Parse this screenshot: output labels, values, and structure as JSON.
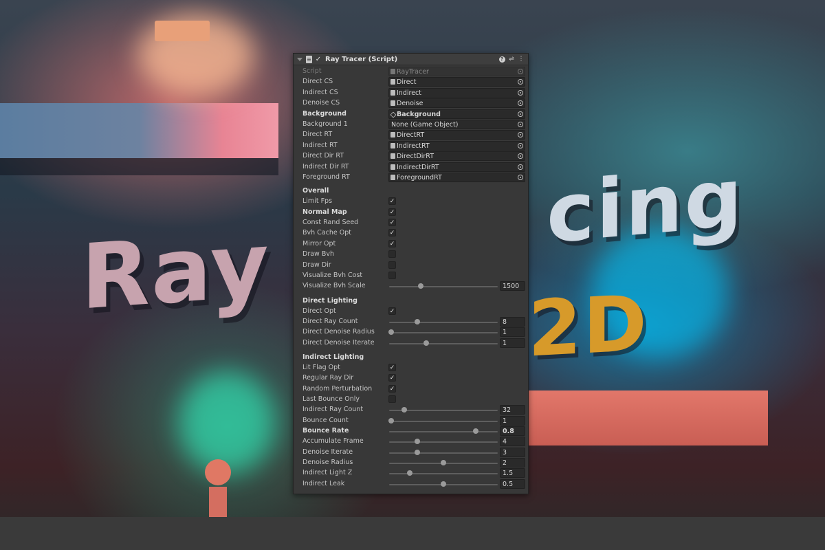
{
  "component": {
    "title": "Ray Tracer (Script)",
    "enabled": true,
    "icons": [
      "foldout-arrow-icon",
      "script-file-icon",
      "help-icon",
      "presets-icon",
      "kebab-menu-icon"
    ]
  },
  "object_fields": [
    {
      "label": "Script",
      "value": "RayTracer",
      "disabled": true,
      "kind": "script"
    },
    {
      "label": "Direct CS",
      "value": "Direct",
      "kind": "compute"
    },
    {
      "label": "Indirect CS",
      "value": "Indirect",
      "kind": "compute"
    },
    {
      "label": "Denoise CS",
      "value": "Denoise",
      "kind": "compute"
    },
    {
      "label": "Background",
      "value": "Background",
      "bold": true,
      "kind": "gameobject"
    },
    {
      "label": "Background 1",
      "value": "None (Game Object)",
      "kind": "none"
    },
    {
      "label": "Direct RT",
      "value": "DirectRT",
      "kind": "rendertexture"
    },
    {
      "label": "Indirect RT",
      "value": "IndirectRT",
      "kind": "rendertexture"
    },
    {
      "label": "Direct Dir RT",
      "value": "DirectDirRT",
      "kind": "rendertexture"
    },
    {
      "label": "Indirect Dir RT",
      "value": "IndirectDirRT",
      "kind": "rendertexture"
    },
    {
      "label": "Foreground RT",
      "value": "ForegroundRT",
      "kind": "rendertexture"
    }
  ],
  "sections": [
    {
      "title": "Overall",
      "fields": [
        {
          "label": "Limit Fps",
          "type": "toggle",
          "checked": true
        },
        {
          "label": "Normal Map",
          "type": "toggle",
          "checked": true,
          "bold": true
        },
        {
          "label": "Const Rand Seed",
          "type": "toggle",
          "checked": true
        },
        {
          "label": "Bvh Cache Opt",
          "type": "toggle",
          "checked": true
        },
        {
          "label": "Mirror Opt",
          "type": "toggle",
          "checked": true
        },
        {
          "label": "Draw Bvh",
          "type": "toggle",
          "checked": false
        },
        {
          "label": "Draw Dir",
          "type": "toggle",
          "checked": false
        },
        {
          "label": "Visualize Bvh Cost",
          "type": "toggle",
          "checked": false
        },
        {
          "label": "Visualize Bvh Scale",
          "type": "slider",
          "value": "1500",
          "fraction": 0.29
        }
      ]
    },
    {
      "title": "Direct Lighting",
      "fields": [
        {
          "label": "Direct Opt",
          "type": "toggle",
          "checked": true
        },
        {
          "label": "Direct Ray Count",
          "type": "slider",
          "value": "8",
          "fraction": 0.26
        },
        {
          "label": "Direct Denoise Radius",
          "type": "slider",
          "value": "1",
          "fraction": 0.02
        },
        {
          "label": "Direct Denoise Iterate",
          "type": "slider",
          "value": "1",
          "fraction": 0.34
        }
      ]
    },
    {
      "title": "Indirect Lighting",
      "fields": [
        {
          "label": "Lit Flag Opt",
          "type": "toggle",
          "checked": true
        },
        {
          "label": "Regular Ray Dir",
          "type": "toggle",
          "checked": true
        },
        {
          "label": "Random Perturbation",
          "type": "toggle",
          "checked": true
        },
        {
          "label": "Last Bounce Only",
          "type": "toggle",
          "checked": false
        },
        {
          "label": "Indirect Ray Count",
          "type": "slider",
          "value": "32",
          "fraction": 0.14
        },
        {
          "label": "Bounce Count",
          "type": "slider",
          "value": "1",
          "fraction": 0.02
        },
        {
          "label": "Bounce Rate",
          "type": "slider",
          "value": "0.8",
          "fraction": 0.8,
          "bold": true
        },
        {
          "label": "Accumulate Frame",
          "type": "slider",
          "value": "4",
          "fraction": 0.26
        },
        {
          "label": "Denoise Iterate",
          "type": "slider",
          "value": "3",
          "fraction": 0.26
        },
        {
          "label": "Denoise Radius",
          "type": "slider",
          "value": "2",
          "fraction": 0.5
        },
        {
          "label": "Indirect Light Z",
          "type": "slider",
          "value": "1.5",
          "fraction": 0.19
        },
        {
          "label": "Indirect Leak",
          "type": "slider",
          "value": "0.5",
          "fraction": 0.5
        }
      ]
    }
  ],
  "scene": {
    "text_left": "Ray",
    "text_right": "cing",
    "text_small": "2D",
    "colors": {
      "panel": "#383838",
      "field": "#2a2a2a",
      "accent_red": "#d86a5e",
      "accent_cyan": "#1fc6e8"
    }
  }
}
